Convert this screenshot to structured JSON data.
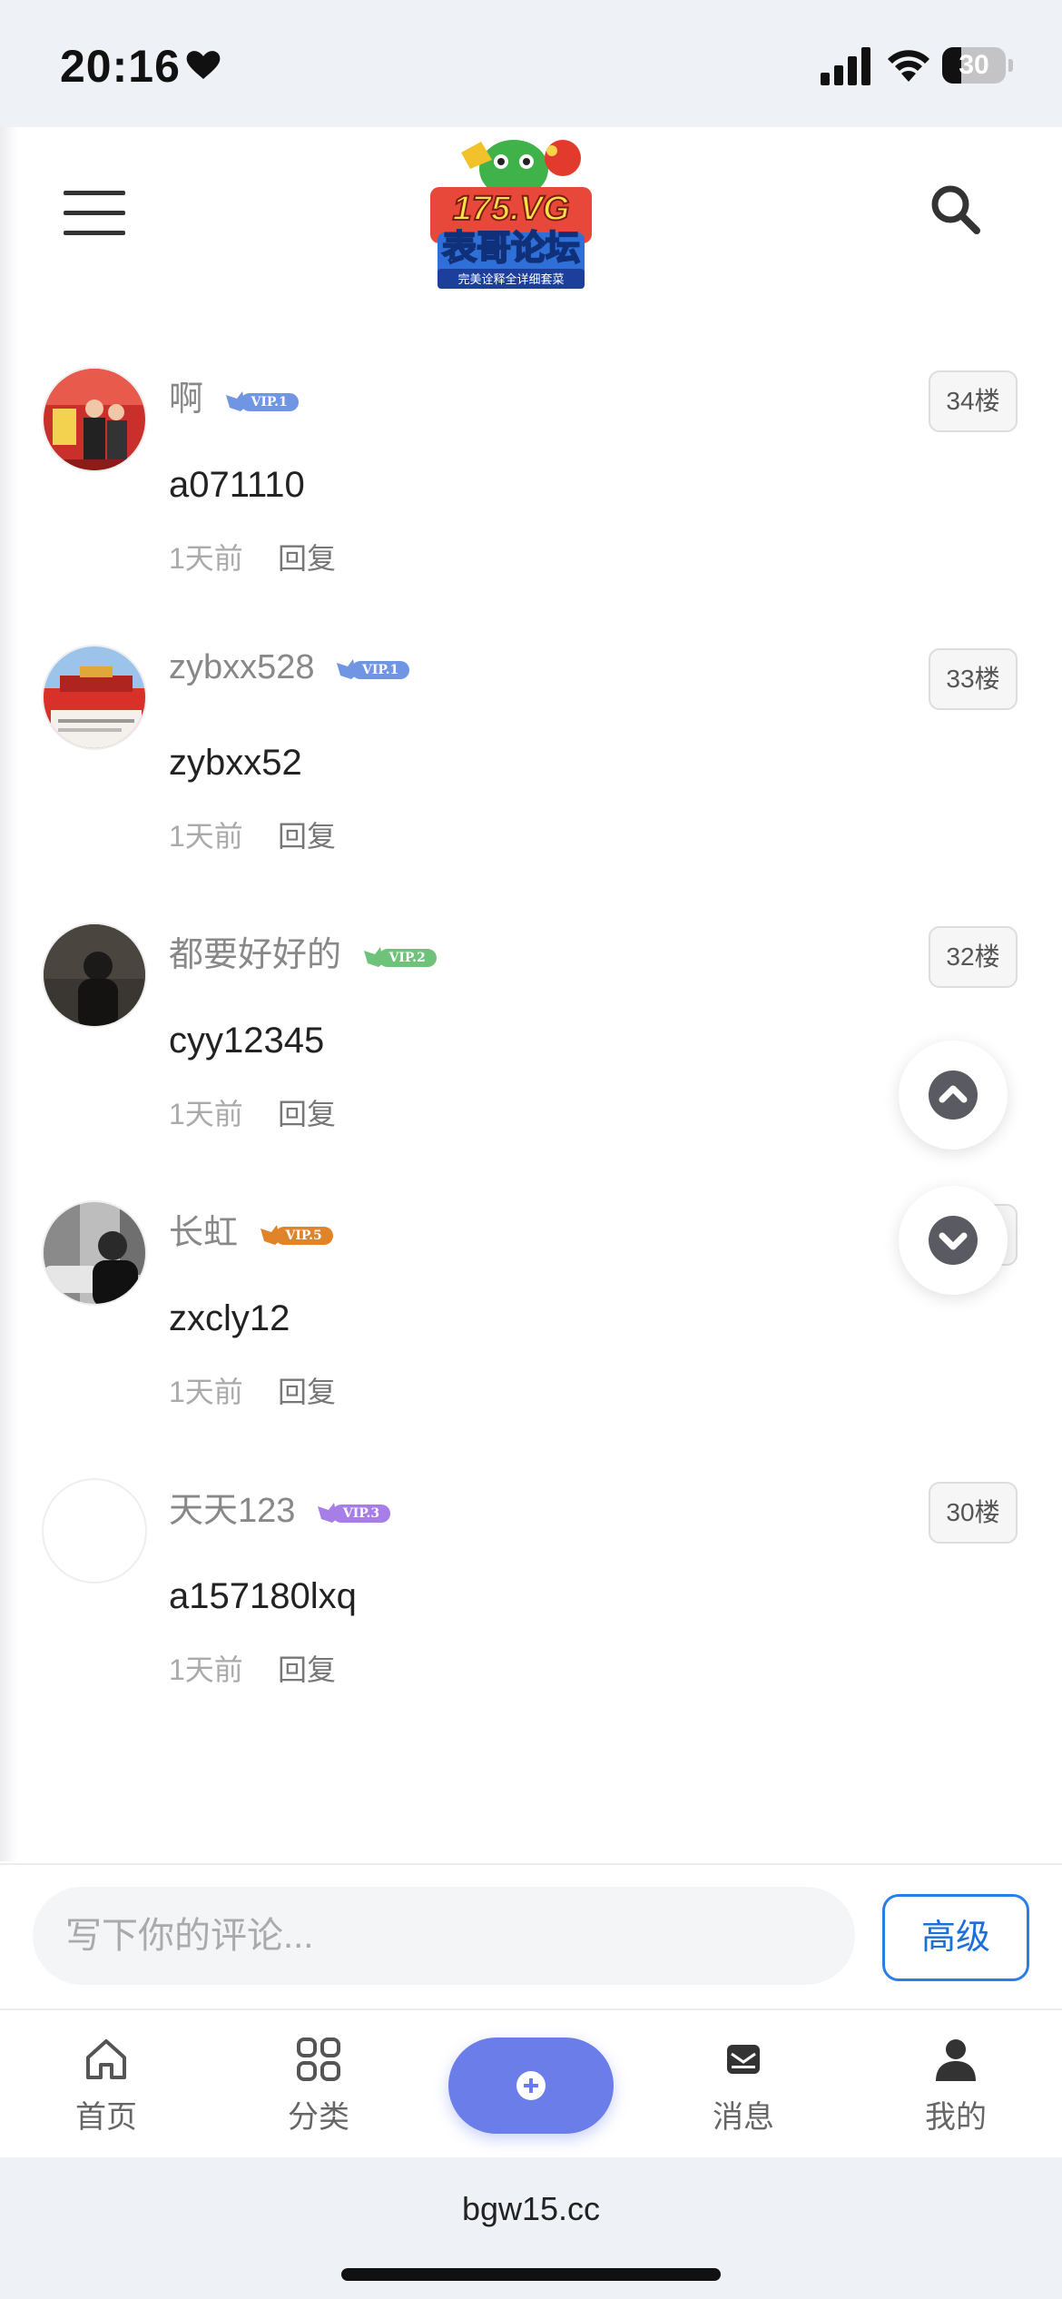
{
  "status_bar": {
    "time": "20:16",
    "battery": "30",
    "battery_level": 0.3
  },
  "header": {
    "logo": {
      "title_top": "175.VG",
      "title_main": "表哥论坛",
      "slogan": "完美诠释全详细套菜"
    }
  },
  "comments": [
    {
      "username": "啊",
      "vip": "VIP.1",
      "vip_color": "#6f95e3",
      "floor": "34楼",
      "content": "a071110",
      "time": "1天前",
      "reply": "回复"
    },
    {
      "username": "zybxx528",
      "vip": "VIP.1",
      "vip_color": "#6f95e3",
      "floor": "33楼",
      "content": "zybxx52",
      "time": "1天前",
      "reply": "回复"
    },
    {
      "username": "都要好好的",
      "vip": "VIP.2",
      "vip_color": "#6fc27a",
      "floor": "32楼",
      "content": "cyy12345",
      "time": "1天前",
      "reply": "回复"
    },
    {
      "username": "长虹",
      "vip": "VIP.5",
      "vip_color": "#e0842a",
      "floor": "",
      "content": "zxcly12",
      "time": "1天前",
      "reply": "回复"
    },
    {
      "username": "天天123",
      "vip": "VIP.3",
      "vip_color": "#a77de8",
      "floor": "30楼",
      "content": "a157180lxq",
      "time": "1天前",
      "reply": "回复"
    }
  ],
  "comment_bar": {
    "placeholder": "写下你的评论...",
    "advanced_label": "高级"
  },
  "bottom_nav": {
    "home": "首页",
    "categories": "分类",
    "messages": "消息",
    "mine": "我的"
  },
  "browser": {
    "url": "bgw15.cc"
  },
  "colors": {
    "accent_blue": "#2a7ee8",
    "post_button": "#6a7de8"
  }
}
